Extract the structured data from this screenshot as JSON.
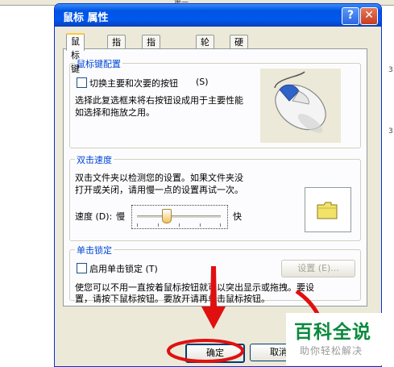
{
  "background": {
    "top_text": "第一",
    "right_text_1": "3",
    "right_text_2": "3"
  },
  "dialog": {
    "title": "鼠标 属性",
    "help_glyph": "?",
    "close_glyph": "✕",
    "tabs": [
      {
        "label": "鼠标键",
        "active": true
      },
      {
        "label": "指针"
      },
      {
        "label": "指针选项"
      },
      {
        "label": "轮"
      },
      {
        "label": "硬件"
      }
    ],
    "button_config": {
      "legend": "鼠标键配置",
      "switch_checkbox_label": "切换主要和次要的按钮",
      "switch_checkbox_hotkey": "(S)",
      "switch_checked": false,
      "description_line1": "选择此复选框来将右按钮设成用于主要性能",
      "description_line2": "如选择和拖放之用。",
      "image_icon": "mouse-icon"
    },
    "double_click": {
      "legend": "双击速度",
      "description_line1": "双击文件夹以检测您的设置。如果文件夹没",
      "description_line2": "打开或关闭，请用慢一点的设置再试一次。",
      "speed_label": "速度 (D):",
      "slow_label": "慢",
      "fast_label": "快",
      "speed_value_fraction": 0.35,
      "test_icon": "folder-icon"
    },
    "click_lock": {
      "legend": "单击锁定",
      "checkbox_label": "启用单击锁定 (T)",
      "checked": false,
      "settings_button": "设置 (E)...",
      "description_line1": "使您可以不用一直按着鼠标按钮就可以突出显示或拖拽。要设",
      "description_line2": "置，请按下鼠标按钮。要放开请再单击鼠标按钮。"
    },
    "buttons": {
      "ok": "确定",
      "cancel": "取消"
    }
  },
  "annotation_color": "#e01010",
  "watermark": {
    "main": "百科全说",
    "sub": "助你轻松解决"
  }
}
